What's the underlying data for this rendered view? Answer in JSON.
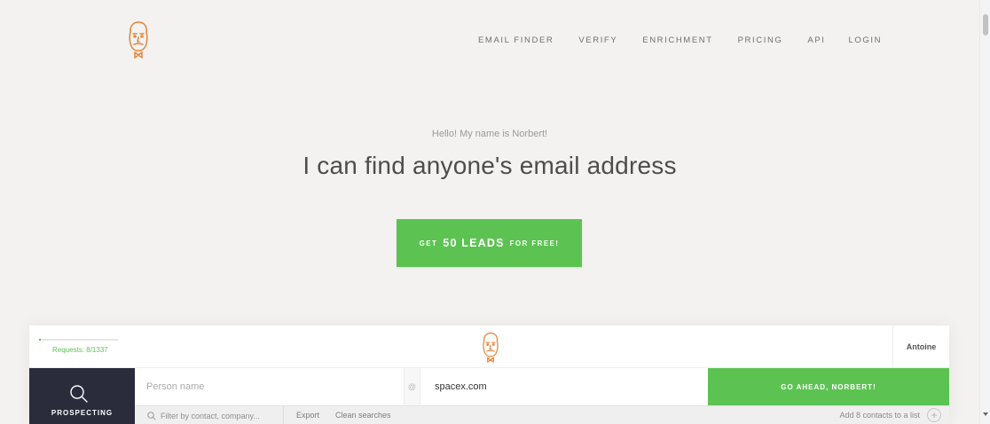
{
  "nav": {
    "items": [
      "EMAIL FINDER",
      "VERIFY",
      "ENRICHMENT",
      "PRICING",
      "API",
      "LOGIN"
    ]
  },
  "hero": {
    "greeting": "Hello! My name is Norbert!",
    "headline": "I can find anyone's email address",
    "cta": {
      "prefix": "GET",
      "highlight": "50 LEADS",
      "suffix": "FOR FREE!"
    }
  },
  "app": {
    "requests_label": "Requests: 8/1337",
    "requests_progress": 0.006,
    "user": "Antoine",
    "sidebar_label": "PROSPECTING",
    "name_placeholder": "Person name",
    "at_symbol": "@",
    "domain_value": "spacex.com",
    "go_button": "GO AHEAD, NORBERT!",
    "filter_placeholder": "Filter by contact, company...",
    "export_label": "Export",
    "clean_label": "Clean searches",
    "add_contacts_label": "Add 8 contacts to a list",
    "add_icon": "+"
  },
  "colors": {
    "accent_green": "#5cc352",
    "logo_orange": "#e8833a",
    "sidebar_dark": "#2a2c3c",
    "background": "#f3f2f0"
  },
  "icons": [
    "norbert-logo-icon",
    "search-icon",
    "plus-circle-icon"
  ]
}
